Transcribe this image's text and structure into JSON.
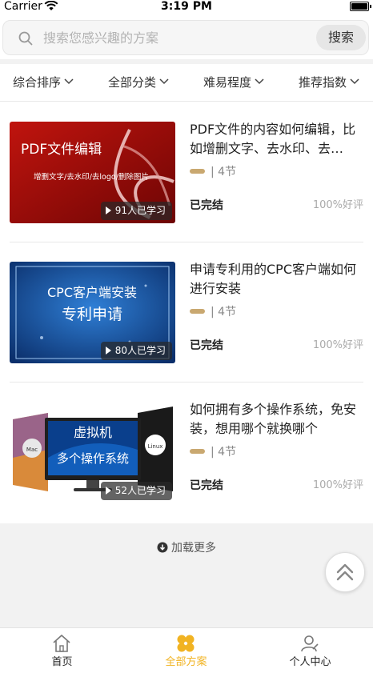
{
  "status_bar": {
    "carrier": "Carrier",
    "time": "3:19 PM"
  },
  "search": {
    "placeholder": "搜索您感兴趣的方案",
    "button_label": "搜索"
  },
  "filters": [
    {
      "label": "综合排序"
    },
    {
      "label": "全部分类"
    },
    {
      "label": "难易程度"
    },
    {
      "label": "推荐指数"
    }
  ],
  "courses": [
    {
      "title": "PDF文件的内容如何编辑，比如增删文字、去水印、去logo、删除图片",
      "thumb_text": [
        "PDF文件编辑",
        "增删文字/去水印/去logo/删除图片"
      ],
      "learners": "91人已学习",
      "lessons": "4节",
      "status": "已完结",
      "rating": "100%好评"
    },
    {
      "title": "申请专利用的CPC客户端如何进行安装",
      "thumb_text": [
        "CPC客户端安装",
        "专利申请"
      ],
      "learners": "80人已学习",
      "lessons": "4节",
      "status": "已完结",
      "rating": "100%好评"
    },
    {
      "title": "如何拥有多个操作系统，免安装，想用哪个就换哪个",
      "thumb_text": [
        "虚拟机",
        "多个操作系统",
        "Mac",
        "Linux"
      ],
      "learners": "52人已学习",
      "lessons": "4节",
      "status": "已完结",
      "rating": "100%好评"
    }
  ],
  "load_more": "加载更多",
  "tabs": [
    {
      "label": "首页",
      "icon": "home-icon"
    },
    {
      "label": "全部方案",
      "icon": "grid-flower-icon"
    },
    {
      "label": "个人中心",
      "icon": "user-icon"
    }
  ],
  "colors": {
    "accent": "#f1b322",
    "lesson_pill": "#c9a870"
  }
}
